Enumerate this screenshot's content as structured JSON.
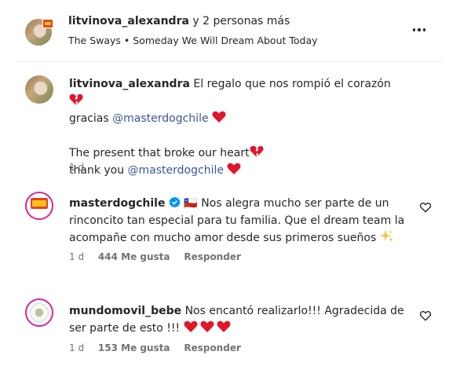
{
  "header": {
    "username": "litvinova_alexandra",
    "collab_suffix": " y 2 personas más",
    "music": "The Sways • Someday We Will Dream About Today"
  },
  "comments": [
    {
      "username": "litvinova_alexandra",
      "line1": " El regalo que nos rompió el corazón ",
      "line2_prefix": "gracias ",
      "mention": "@masterdogchile",
      "line3": "The present that broke our heart",
      "line4_prefix": "thank you ",
      "mention2": "@masterdogchile",
      "time": "1 d"
    },
    {
      "username": "masterdogchile",
      "flag_text": "🇨🇱",
      "text": "Nos alegra mucho ser parte de un rinconcito tan especial para tu familia. Que el dream team la acompañe con mucho amor desde sus primeros sueños",
      "time": "1 d",
      "likes": "444 Me gusta",
      "reply": "Responder"
    },
    {
      "username": "mundomovil_bebe",
      "text": "Nos encantó realizarlo!!! Agradecida de ser parte de esto !!!",
      "time": "1 d",
      "likes": "153 Me gusta",
      "reply": "Responder"
    }
  ],
  "colors": {
    "text": "#262626",
    "muted": "#737373",
    "mention": "#385898",
    "heart": "#e0162b",
    "verified": "#0095f6"
  }
}
